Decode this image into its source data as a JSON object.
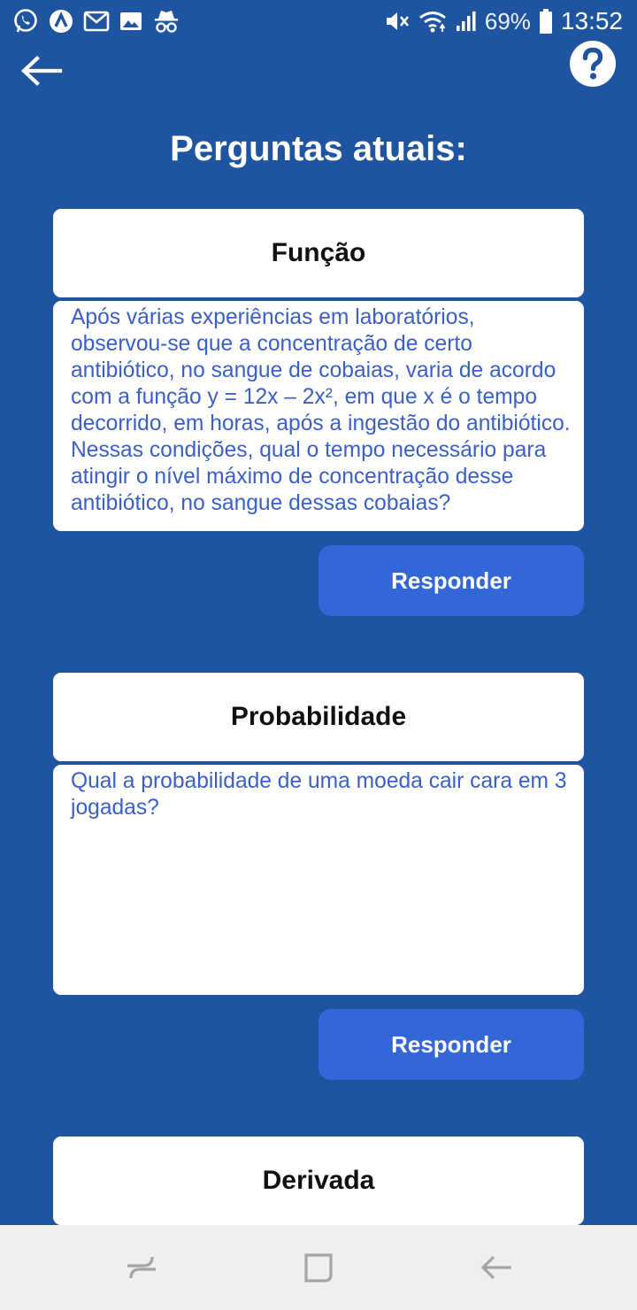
{
  "status_bar": {
    "battery_percent": "69%",
    "time": "13:52"
  },
  "header": {
    "back_icon": "arrow-left-icon",
    "help_icon": "help-circle-icon",
    "title": "Perguntas atuais:"
  },
  "questions": [
    {
      "topic": "Função",
      "text": " Após várias experiências em laboratórios, observou-se que a concentração de certo antibiótico, no sangue de cobaias, varia de acordo com a função y = 12x – 2x², em que x é o tempo decorrido, em horas, após a ingestão do antibiótico. Nessas condições, qual o tempo necessário para atingir o nível máximo de concentração desse antibiótico, no sangue dessas cobaias?",
      "answer_label": "Responder"
    },
    {
      "topic": "Probabilidade",
      "text": " Qual a probabilidade de uma moeda cair cara em 3 jogadas?",
      "answer_label": "Responder"
    },
    {
      "topic": "Derivada"
    }
  ],
  "colors": {
    "background": "#1f55a0",
    "card": "#ffffff",
    "question_text": "#3a5fc6",
    "button": "#3366d6"
  }
}
